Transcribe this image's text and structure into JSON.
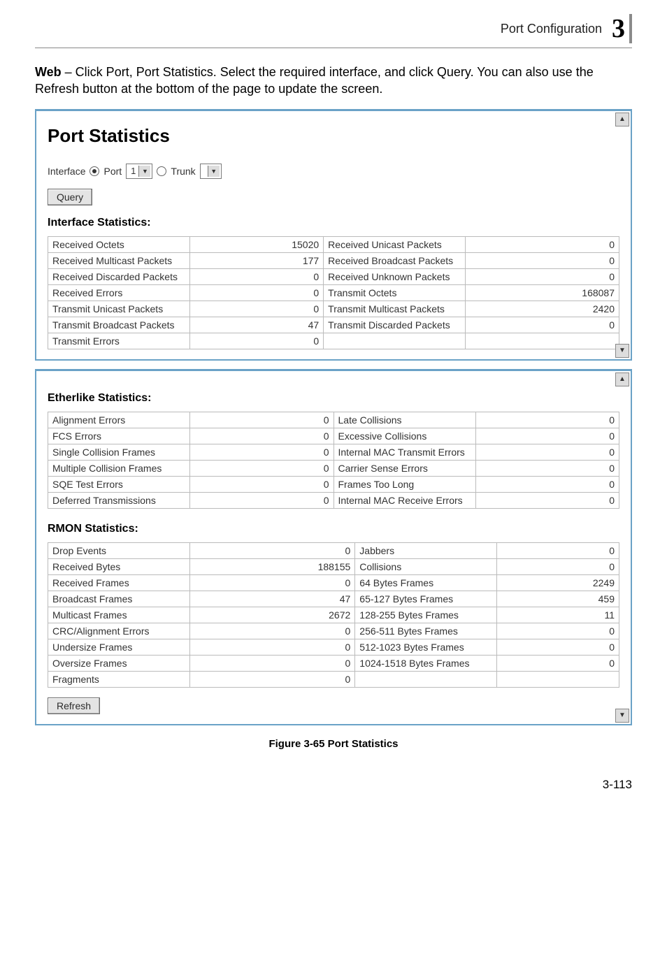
{
  "header": {
    "section": "Port Configuration",
    "chapter_number": "3"
  },
  "intro": {
    "bold": "Web",
    "text": " – Click Port, Port Statistics. Select the required interface, and click Query. You can also use the Refresh button at the bottom of the page to update the screen."
  },
  "panel1": {
    "title": "Port Statistics",
    "interface_label": "Interface",
    "port_label": "Port",
    "port_value": "1",
    "trunk_label": "Trunk",
    "trunk_value": "",
    "query_label": "Query",
    "iface_stats_label": "Interface Statistics:",
    "iface_rows": [
      {
        "l1": "Received Octets",
        "v1": "15020",
        "l2": "Received Unicast Packets",
        "v2": "0"
      },
      {
        "l1": "Received Multicast Packets",
        "v1": "177",
        "l2": "Received Broadcast Packets",
        "v2": "0"
      },
      {
        "l1": "Received Discarded Packets",
        "v1": "0",
        "l2": "Received Unknown Packets",
        "v2": "0"
      },
      {
        "l1": "Received Errors",
        "v1": "0",
        "l2": "Transmit Octets",
        "v2": "168087"
      },
      {
        "l1": "Transmit Unicast Packets",
        "v1": "0",
        "l2": "Transmit Multicast Packets",
        "v2": "2420"
      },
      {
        "l1": "Transmit Broadcast Packets",
        "v1": "47",
        "l2": "Transmit Discarded Packets",
        "v2": "0"
      },
      {
        "l1": "Transmit Errors",
        "v1": "0",
        "l2": "",
        "v2": ""
      }
    ]
  },
  "panel2": {
    "ether_label": "Etherlike Statistics:",
    "ether_rows": [
      {
        "l1": "Alignment Errors",
        "v1": "0",
        "l2": "Late Collisions",
        "v2": "0"
      },
      {
        "l1": "FCS Errors",
        "v1": "0",
        "l2": "Excessive Collisions",
        "v2": "0"
      },
      {
        "l1": "Single Collision Frames",
        "v1": "0",
        "l2": "Internal MAC Transmit Errors",
        "v2": "0"
      },
      {
        "l1": "Multiple Collision Frames",
        "v1": "0",
        "l2": "Carrier Sense Errors",
        "v2": "0"
      },
      {
        "l1": "SQE Test Errors",
        "v1": "0",
        "l2": "Frames Too Long",
        "v2": "0"
      },
      {
        "l1": "Deferred Transmissions",
        "v1": "0",
        "l2": "Internal MAC Receive Errors",
        "v2": "0"
      }
    ],
    "rmon_label": "RMON Statistics:",
    "rmon_rows": [
      {
        "l1": "Drop Events",
        "v1": "0",
        "l2": "Jabbers",
        "v2": "0"
      },
      {
        "l1": "Received Bytes",
        "v1": "188155",
        "l2": "Collisions",
        "v2": "0"
      },
      {
        "l1": "Received Frames",
        "v1": "0",
        "l2": "64 Bytes Frames",
        "v2": "2249"
      },
      {
        "l1": "Broadcast Frames",
        "v1": "47",
        "l2": "65-127 Bytes Frames",
        "v2": "459"
      },
      {
        "l1": "Multicast Frames",
        "v1": "2672",
        "l2": "128-255 Bytes Frames",
        "v2": "11"
      },
      {
        "l1": "CRC/Alignment Errors",
        "v1": "0",
        "l2": "256-511 Bytes Frames",
        "v2": "0"
      },
      {
        "l1": "Undersize Frames",
        "v1": "0",
        "l2": "512-1023 Bytes Frames",
        "v2": "0"
      },
      {
        "l1": "Oversize Frames",
        "v1": "0",
        "l2": "1024-1518 Bytes Frames",
        "v2": "0"
      },
      {
        "l1": "Fragments",
        "v1": "0",
        "l2": "",
        "v2": ""
      }
    ],
    "refresh_label": "Refresh"
  },
  "figure_caption": "Figure 3-65  Port Statistics",
  "page_number": "3-113"
}
